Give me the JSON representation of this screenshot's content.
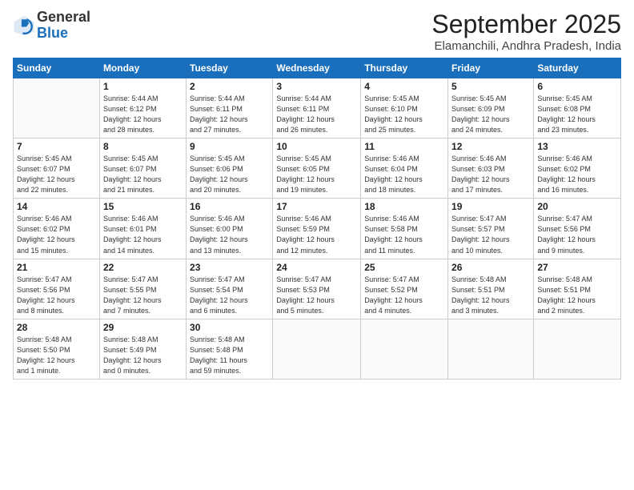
{
  "logo": {
    "line1": "General",
    "line2": "Blue"
  },
  "title": "September 2025",
  "location": "Elamanchili, Andhra Pradesh, India",
  "weekdays": [
    "Sunday",
    "Monday",
    "Tuesday",
    "Wednesday",
    "Thursday",
    "Friday",
    "Saturday"
  ],
  "weeks": [
    [
      {
        "day": "",
        "info": ""
      },
      {
        "day": "1",
        "info": "Sunrise: 5:44 AM\nSunset: 6:12 PM\nDaylight: 12 hours\nand 28 minutes."
      },
      {
        "day": "2",
        "info": "Sunrise: 5:44 AM\nSunset: 6:11 PM\nDaylight: 12 hours\nand 27 minutes."
      },
      {
        "day": "3",
        "info": "Sunrise: 5:44 AM\nSunset: 6:11 PM\nDaylight: 12 hours\nand 26 minutes."
      },
      {
        "day": "4",
        "info": "Sunrise: 5:45 AM\nSunset: 6:10 PM\nDaylight: 12 hours\nand 25 minutes."
      },
      {
        "day": "5",
        "info": "Sunrise: 5:45 AM\nSunset: 6:09 PM\nDaylight: 12 hours\nand 24 minutes."
      },
      {
        "day": "6",
        "info": "Sunrise: 5:45 AM\nSunset: 6:08 PM\nDaylight: 12 hours\nand 23 minutes."
      }
    ],
    [
      {
        "day": "7",
        "info": "Sunrise: 5:45 AM\nSunset: 6:07 PM\nDaylight: 12 hours\nand 22 minutes."
      },
      {
        "day": "8",
        "info": "Sunrise: 5:45 AM\nSunset: 6:07 PM\nDaylight: 12 hours\nand 21 minutes."
      },
      {
        "day": "9",
        "info": "Sunrise: 5:45 AM\nSunset: 6:06 PM\nDaylight: 12 hours\nand 20 minutes."
      },
      {
        "day": "10",
        "info": "Sunrise: 5:45 AM\nSunset: 6:05 PM\nDaylight: 12 hours\nand 19 minutes."
      },
      {
        "day": "11",
        "info": "Sunrise: 5:46 AM\nSunset: 6:04 PM\nDaylight: 12 hours\nand 18 minutes."
      },
      {
        "day": "12",
        "info": "Sunrise: 5:46 AM\nSunset: 6:03 PM\nDaylight: 12 hours\nand 17 minutes."
      },
      {
        "day": "13",
        "info": "Sunrise: 5:46 AM\nSunset: 6:02 PM\nDaylight: 12 hours\nand 16 minutes."
      }
    ],
    [
      {
        "day": "14",
        "info": "Sunrise: 5:46 AM\nSunset: 6:02 PM\nDaylight: 12 hours\nand 15 minutes."
      },
      {
        "day": "15",
        "info": "Sunrise: 5:46 AM\nSunset: 6:01 PM\nDaylight: 12 hours\nand 14 minutes."
      },
      {
        "day": "16",
        "info": "Sunrise: 5:46 AM\nSunset: 6:00 PM\nDaylight: 12 hours\nand 13 minutes."
      },
      {
        "day": "17",
        "info": "Sunrise: 5:46 AM\nSunset: 5:59 PM\nDaylight: 12 hours\nand 12 minutes."
      },
      {
        "day": "18",
        "info": "Sunrise: 5:46 AM\nSunset: 5:58 PM\nDaylight: 12 hours\nand 11 minutes."
      },
      {
        "day": "19",
        "info": "Sunrise: 5:47 AM\nSunset: 5:57 PM\nDaylight: 12 hours\nand 10 minutes."
      },
      {
        "day": "20",
        "info": "Sunrise: 5:47 AM\nSunset: 5:56 PM\nDaylight: 12 hours\nand 9 minutes."
      }
    ],
    [
      {
        "day": "21",
        "info": "Sunrise: 5:47 AM\nSunset: 5:56 PM\nDaylight: 12 hours\nand 8 minutes."
      },
      {
        "day": "22",
        "info": "Sunrise: 5:47 AM\nSunset: 5:55 PM\nDaylight: 12 hours\nand 7 minutes."
      },
      {
        "day": "23",
        "info": "Sunrise: 5:47 AM\nSunset: 5:54 PM\nDaylight: 12 hours\nand 6 minutes."
      },
      {
        "day": "24",
        "info": "Sunrise: 5:47 AM\nSunset: 5:53 PM\nDaylight: 12 hours\nand 5 minutes."
      },
      {
        "day": "25",
        "info": "Sunrise: 5:47 AM\nSunset: 5:52 PM\nDaylight: 12 hours\nand 4 minutes."
      },
      {
        "day": "26",
        "info": "Sunrise: 5:48 AM\nSunset: 5:51 PM\nDaylight: 12 hours\nand 3 minutes."
      },
      {
        "day": "27",
        "info": "Sunrise: 5:48 AM\nSunset: 5:51 PM\nDaylight: 12 hours\nand 2 minutes."
      }
    ],
    [
      {
        "day": "28",
        "info": "Sunrise: 5:48 AM\nSunset: 5:50 PM\nDaylight: 12 hours\nand 1 minute."
      },
      {
        "day": "29",
        "info": "Sunrise: 5:48 AM\nSunset: 5:49 PM\nDaylight: 12 hours\nand 0 minutes."
      },
      {
        "day": "30",
        "info": "Sunrise: 5:48 AM\nSunset: 5:48 PM\nDaylight: 11 hours\nand 59 minutes."
      },
      {
        "day": "",
        "info": ""
      },
      {
        "day": "",
        "info": ""
      },
      {
        "day": "",
        "info": ""
      },
      {
        "day": "",
        "info": ""
      }
    ]
  ]
}
